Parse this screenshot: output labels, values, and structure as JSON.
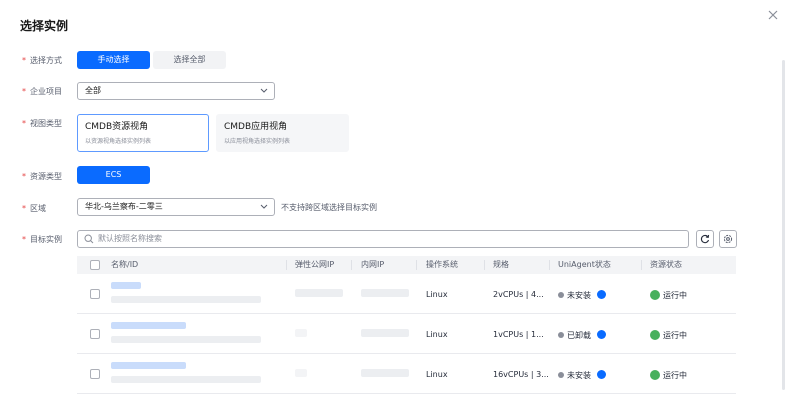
{
  "dialog": {
    "title": "选择实例"
  },
  "form": {
    "select_mode": {
      "label": "选择方式",
      "options": [
        "手动选择",
        "选择全部"
      ],
      "selected": "手动选择"
    },
    "enterprise_project": {
      "label": "企业项目",
      "value": "全部"
    },
    "view_type": {
      "label": "视图类型",
      "cards": [
        {
          "title": "CMDB资源视角",
          "subtitle": "以资源视角选择实例列表",
          "active": true
        },
        {
          "title": "CMDB应用视角",
          "subtitle": "以应用视角选择实例列表",
          "active": false
        }
      ]
    },
    "resource_type": {
      "label": "资源类型",
      "value": "ECS"
    },
    "region": {
      "label": "区域",
      "value": "华北-乌兰察布-二零三",
      "hint": "不支持跨区域选择目标实例"
    },
    "target_instance": {
      "label": "目标实例",
      "search_placeholder": "默认按照名称搜索"
    }
  },
  "table": {
    "columns": [
      "名称/ID",
      "弹性公网IP",
      "内网IP",
      "操作系统",
      "规格",
      "UniAgent状态",
      "资源状态"
    ],
    "rows": [
      {
        "os": "Linux",
        "spec": "2vCPUs | 4...",
        "agent": "未安装",
        "status": "运行中"
      },
      {
        "os": "Linux",
        "spec": "1vCPUs | 1...",
        "agent": "已卸载",
        "status": "运行中"
      },
      {
        "os": "Linux",
        "spec": "16vCPUs | 3...",
        "agent": "未安装",
        "status": "运行中"
      }
    ]
  },
  "colors": {
    "primary": "#0a6bff",
    "required": "#e54545",
    "running": "#47b05d"
  }
}
